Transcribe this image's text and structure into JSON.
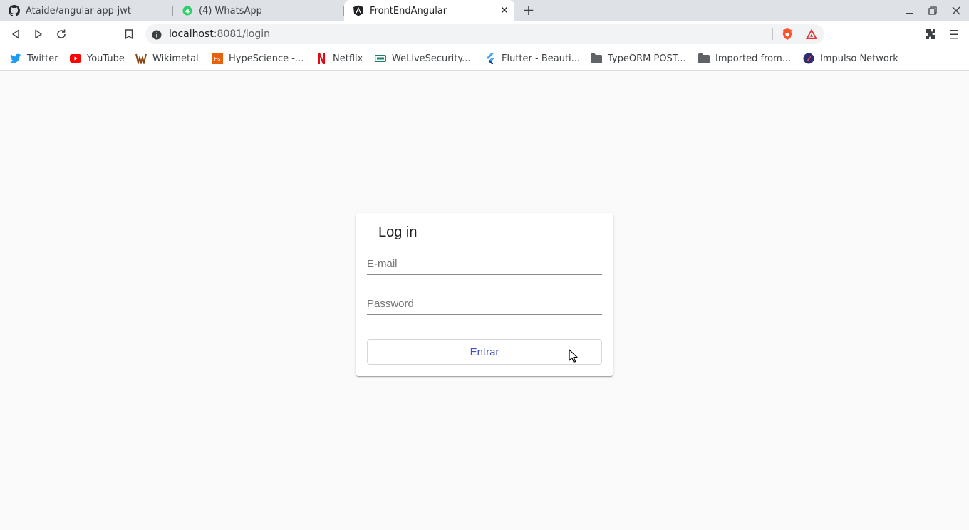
{
  "browser": {
    "tabs": [
      {
        "title": "Ataide/angular-app-jwt",
        "icon": "github-icon"
      },
      {
        "title": "(4) WhatsApp",
        "icon": "whatsapp-icon"
      },
      {
        "title": "FrontEndAngular",
        "icon": "angular-icon",
        "active": true
      }
    ],
    "address": {
      "host": "localhost",
      "path": ":8081/login"
    },
    "bookmarks": [
      {
        "label": "Twitter",
        "icon": "twitter-icon"
      },
      {
        "label": "YouTube",
        "icon": "youtube-icon"
      },
      {
        "label": "Wikimetal",
        "icon": "wikimetal-icon"
      },
      {
        "label": "HypeScience -...",
        "icon": "hypescience-icon"
      },
      {
        "label": "Netflix",
        "icon": "netflix-icon"
      },
      {
        "label": "WeLiveSecurity...",
        "icon": "welivesecurity-icon"
      },
      {
        "label": "Flutter - Beauti...",
        "icon": "flutter-icon"
      },
      {
        "label": "TypeORM POST...",
        "icon": "folder-icon"
      },
      {
        "label": "Imported from...",
        "icon": "folder-icon"
      },
      {
        "label": "Impulso Network",
        "icon": "impulso-icon"
      }
    ]
  },
  "login": {
    "title": "Log in",
    "email_placeholder": "E-mail",
    "password_placeholder": "Password",
    "submit_label": "Entrar"
  },
  "colors": {
    "accent": "#3f51b5",
    "page_bg": "#fafafa",
    "tabstrip_bg": "#dee1e6"
  }
}
